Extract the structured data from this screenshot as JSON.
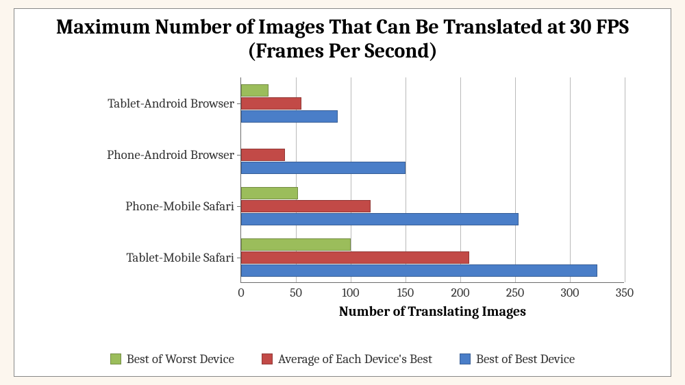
{
  "chart_data": {
    "type": "bar",
    "orientation": "horizontal",
    "title": "Maximum Number of Images That Can Be Translated at 30 FPS (Frames Per Second)",
    "xlabel": "Number of Translating Images",
    "ylabel": "",
    "xlim": [
      0,
      350
    ],
    "xticks": [
      0,
      50,
      100,
      150,
      200,
      250,
      300,
      350
    ],
    "categories": [
      "Tablet-Mobile Safari",
      "Phone-Mobile Safari",
      "Phone-Android Browser",
      "Tablet-Android Browser"
    ],
    "series": [
      {
        "name": "Best of Worst Device",
        "color": "#9bbd5b",
        "values": [
          100,
          52,
          0,
          25
        ]
      },
      {
        "name": "Average of Each Device's Best",
        "color": "#c24a47",
        "values": [
          208,
          118,
          40,
          55
        ]
      },
      {
        "name": "Best of Best Device",
        "color": "#4a7ec8",
        "values": [
          325,
          253,
          150,
          88
        ]
      }
    ],
    "legend_position": "bottom"
  }
}
